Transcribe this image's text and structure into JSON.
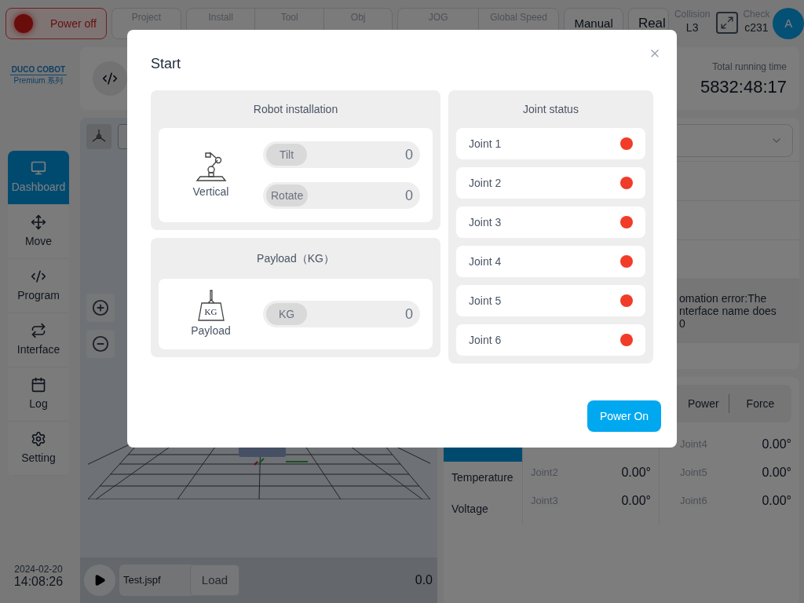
{
  "top_bar": {
    "power_button": {
      "label": "Power off",
      "on": false
    },
    "groups": [
      {
        "items": [
          {
            "label": "Project"
          }
        ]
      },
      {
        "items": [
          {
            "label": "Install"
          },
          {
            "label": "Tool"
          },
          {
            "label": "Obj"
          }
        ]
      },
      {
        "items": [
          {
            "label": "JOG"
          },
          {
            "label": "Global Speed"
          }
        ]
      }
    ],
    "mode_buttons": [
      "Manual",
      "Real"
    ],
    "collision": {
      "label": "Collision",
      "value": "L3"
    },
    "check": {
      "label": "Check",
      "value": "c231"
    },
    "avatar": "A"
  },
  "logo": {
    "brand": "DUCO COBOT",
    "series": "Premium 系列"
  },
  "nav": [
    {
      "label": "Dashboard",
      "selected": true
    },
    {
      "label": "Move",
      "selected": false
    },
    {
      "label": "Program",
      "selected": false
    },
    {
      "label": "Interface",
      "selected": false
    },
    {
      "label": "Log",
      "selected": false
    },
    {
      "label": "Setting",
      "selected": false
    }
  ],
  "datetime": {
    "date": "2024-02-20",
    "time": "14:08:26"
  },
  "running_time": {
    "label": "Total running time",
    "value": "5832:48:17"
  },
  "viewer": {
    "file": "Test.jspf",
    "load_button": "Load",
    "reading": "0.0"
  },
  "status_panel": {
    "error_text": "omation error:The\nnterface name does\n0"
  },
  "joint_panel": {
    "tabs": [
      {
        "label": "Power",
        "selected": false
      },
      {
        "label": "Force",
        "selected": false
      }
    ],
    "side_tabs": [
      {
        "selected": true
      },
      {
        "label": "Temperature",
        "selected": false
      },
      {
        "label": "Voltage",
        "selected": false
      }
    ],
    "left_readings": [
      {
        "name": "Joint2",
        "value": "0.00°"
      },
      {
        "name": "Joint3",
        "value": "0.00°"
      }
    ],
    "right_readings": [
      {
        "name": "Joint4",
        "value": "0.00°"
      },
      {
        "name": "Joint5",
        "value": "0.00°"
      },
      {
        "name": "Joint6",
        "value": "0.00°"
      }
    ]
  },
  "dialog": {
    "title": "Start",
    "installation": {
      "title": "Robot installation",
      "mount": "Vertical",
      "fields": [
        {
          "label": "Tilt",
          "value": "0"
        },
        {
          "label": "Rotate",
          "value": "0"
        }
      ]
    },
    "payload": {
      "title": "Payload（KG）",
      "icon_label": "KG",
      "caption": "Payload",
      "fields": [
        {
          "label": "KG",
          "value": "0"
        }
      ]
    },
    "joint_status": {
      "title": "Joint status",
      "joints": [
        {
          "name": "Joint 1",
          "color": "#f03c28"
        },
        {
          "name": "Joint 2",
          "color": "#f03c28"
        },
        {
          "name": "Joint 3",
          "color": "#f03c28"
        },
        {
          "name": "Joint 4",
          "color": "#f03c28"
        },
        {
          "name": "Joint 5",
          "color": "#f03c28"
        },
        {
          "name": "Joint 6",
          "color": "#f03c28"
        }
      ]
    },
    "primary_button": "Power On"
  }
}
